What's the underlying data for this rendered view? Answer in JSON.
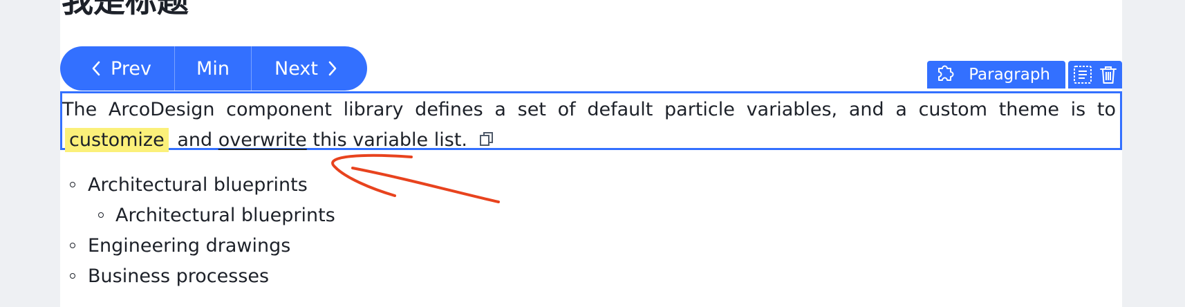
{
  "page": {
    "title": "我是标题"
  },
  "nav": {
    "prev_label": "Prev",
    "min_label": "Min",
    "next_label": "Next"
  },
  "block_toolbar": {
    "type_label": "Paragraph",
    "type_icon": "puzzle-icon",
    "actions": [
      "format-icon",
      "trash-icon"
    ]
  },
  "paragraph": {
    "text_before": "The ArcoDesign component library defines a set of default particle variables, and a custom theme is to",
    "highlight": "customize",
    "text_middle": "and",
    "underlined": "overwrite",
    "text_after": "this variable list.",
    "copy_icon": "copy-icon"
  },
  "list": {
    "items": [
      {
        "text": "Architectural blueprints"
      },
      {
        "text": "Architectural blueprints"
      },
      {
        "text": "Engineering drawings"
      },
      {
        "text": "Business processes"
      }
    ]
  },
  "colors": {
    "accent": "#3370ff",
    "highlight": "#fbf07a",
    "annotation": "#e8431e",
    "text": "#1d2129"
  }
}
